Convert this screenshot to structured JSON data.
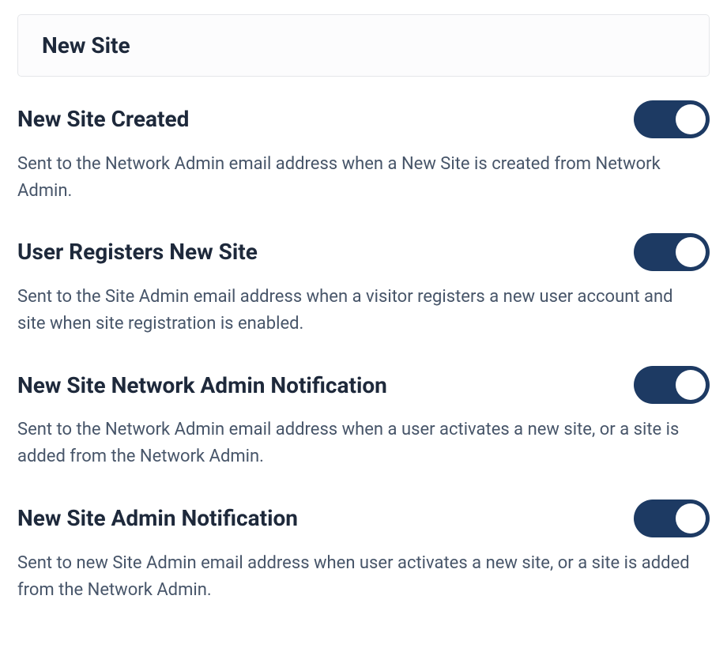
{
  "colors": {
    "toggle_on": "#1d3a63",
    "text_primary": "#1e293b",
    "text_secondary": "#475569",
    "border": "#e5e7ea"
  },
  "section": {
    "title": "New Site"
  },
  "settings": [
    {
      "key": "new-site-created",
      "title": "New Site Created",
      "description": "Sent to the Network Admin email address when a New Site is created from Network Admin.",
      "enabled": true
    },
    {
      "key": "user-registers-new-site",
      "title": "User Registers New Site",
      "description": "Sent to the Site Admin email address when a visitor registers a new user account and site when site registration is enabled.",
      "enabled": true
    },
    {
      "key": "new-site-network-admin-notification",
      "title": "New Site Network Admin Notification",
      "description": "Sent to the Network Admin email address when a user activates a new site, or a site is added from the Network Admin.",
      "enabled": true
    },
    {
      "key": "new-site-admin-notification",
      "title": "New Site Admin Notification",
      "description": "Sent to new Site Admin email address when user activates a new site, or a site is added from the Network Admin.",
      "enabled": true
    }
  ]
}
